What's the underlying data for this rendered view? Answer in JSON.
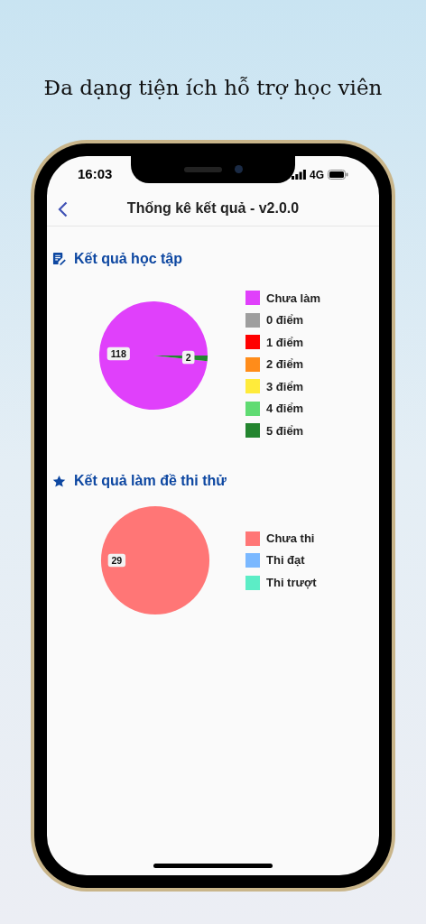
{
  "headline": "Đa dạng tiện ích hỗ trợ học viên",
  "status_bar": {
    "time": "16:03",
    "network": "4G"
  },
  "nav": {
    "title": "Thống kê kết quả - v2.0.0"
  },
  "sections": [
    {
      "kind": "notes",
      "title": "Kết quả học tập",
      "chart_data": {
        "type": "pie",
        "categories": [
          "Chưa làm",
          "0 điểm",
          "1 điểm",
          "2 điểm",
          "3 điểm",
          "4 điểm",
          "5 điểm"
        ],
        "colors": [
          "#e040fb",
          "#9e9e9e",
          "#ff0000",
          "#ff8c1a",
          "#ffeb3b",
          "#5fdb72",
          "#23852f"
        ],
        "values": [
          118,
          0,
          0,
          0,
          0,
          0,
          2
        ],
        "data_labels": true
      }
    },
    {
      "kind": "star",
      "title": "Kết quả làm đề thi thử",
      "chart_data": {
        "type": "pie",
        "categories": [
          "Chưa thi",
          "Thi đạt",
          "Thi trượt"
        ],
        "colors": [
          "#ff7676",
          "#7ab8ff",
          "#5cedc6"
        ],
        "values": [
          29,
          0,
          0
        ],
        "data_labels": true
      }
    }
  ]
}
